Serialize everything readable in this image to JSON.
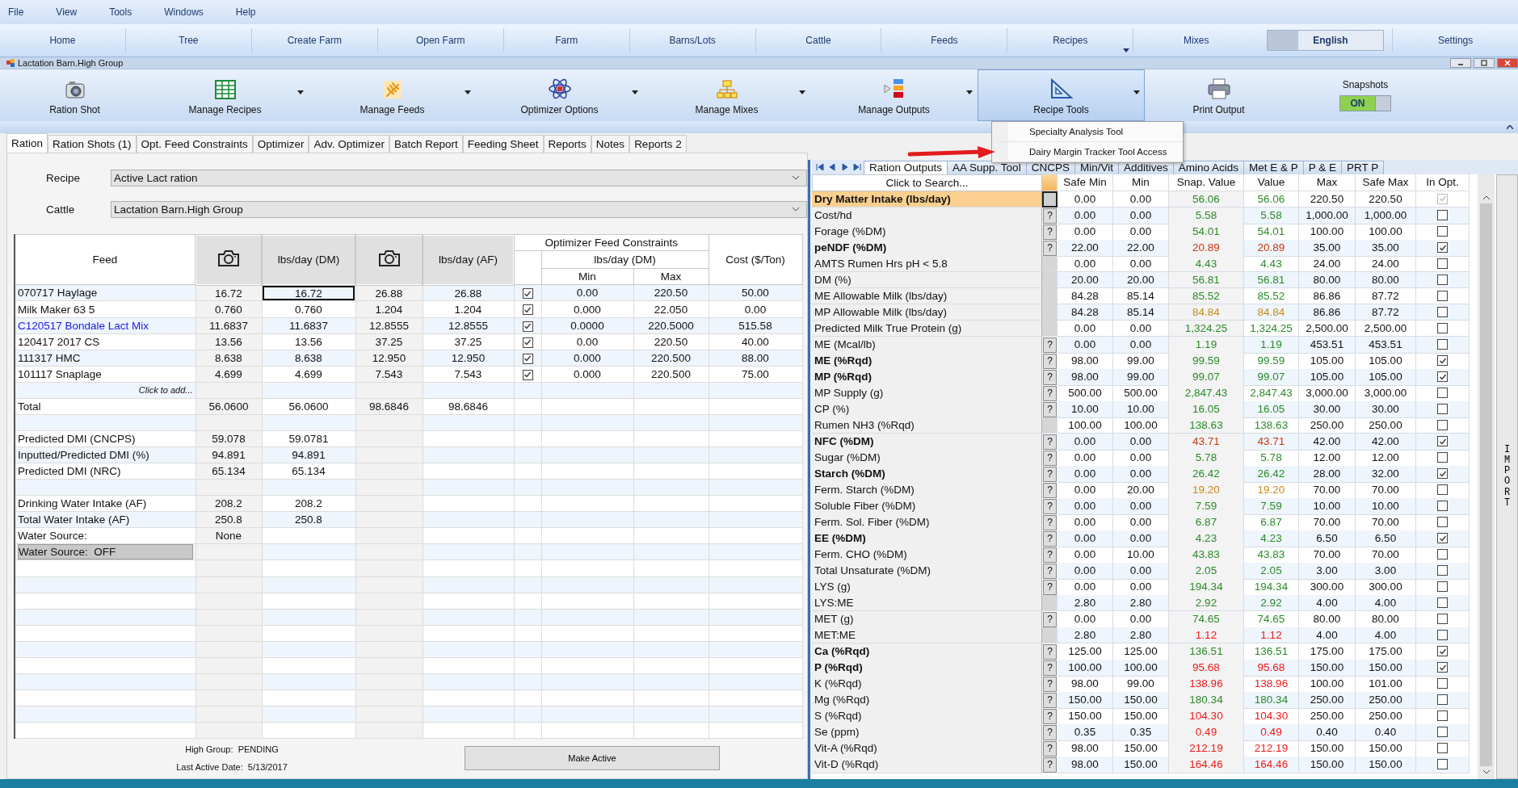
{
  "menu_bar": [
    "File",
    "View",
    "Tools",
    "Windows",
    "Help"
  ],
  "nav": [
    {
      "label": "Home",
      "kind": "link"
    },
    {
      "label": "Tree",
      "kind": "link"
    },
    {
      "label": "Create Farm",
      "kind": "link"
    },
    {
      "label": "Open Farm",
      "kind": "link"
    },
    {
      "label": "Farm",
      "kind": "link"
    },
    {
      "label": "Barns/Lots",
      "kind": "link"
    },
    {
      "label": "Cattle",
      "kind": "link"
    },
    {
      "label": "Feeds",
      "kind": "link"
    },
    {
      "label": "Recipes",
      "kind": "dropdown"
    },
    {
      "label": "Mixes",
      "kind": "link"
    },
    {
      "label": "English",
      "kind": "language"
    },
    {
      "label": "Settings",
      "kind": "link"
    }
  ],
  "window": {
    "title": "Lactation Barn.High Group"
  },
  "toolbar": [
    {
      "label": "Ration Shot",
      "kind": "camera",
      "dropdown": false,
      "selected": false
    },
    {
      "label": "Manage Recipes",
      "kind": "grid",
      "dropdown": true,
      "selected": false
    },
    {
      "label": "Manage Feeds",
      "kind": "wheat",
      "dropdown": true,
      "selected": false
    },
    {
      "label": "Optimizer Options",
      "kind": "atom",
      "dropdown": true,
      "selected": false
    },
    {
      "label": "Manage Mixes",
      "kind": "hierarchy",
      "dropdown": true,
      "selected": false
    },
    {
      "label": "Manage Outputs",
      "kind": "outputs",
      "dropdown": true,
      "selected": false
    },
    {
      "label": "Recipe Tools",
      "kind": "setsquare",
      "dropdown": true,
      "selected": true,
      "menu": [
        "Specialty Analysis Tool",
        "Dairy Margin Tracker Tool Access"
      ]
    },
    {
      "label": "Print Output",
      "kind": "printer",
      "dropdown": false,
      "selected": false
    }
  ],
  "snapshots": {
    "label": "Snapshots",
    "state": "ON",
    "on": true
  },
  "tabs": [
    {
      "label": "Ration",
      "selected": true
    },
    {
      "label": "Ration Shots (1)",
      "selected": false
    },
    {
      "label": "Opt. Feed Constraints",
      "selected": false
    },
    {
      "label": "Optimizer",
      "selected": false
    },
    {
      "label": "Adv. Optimizer",
      "selected": false
    },
    {
      "label": "Batch Report",
      "selected": false
    },
    {
      "label": "Feeding Sheet",
      "selected": false
    },
    {
      "label": "Reports",
      "selected": false
    },
    {
      "label": "Notes",
      "selected": false
    },
    {
      "label": "Reports 2",
      "selected": false
    }
  ],
  "fields": [
    {
      "label": "Recipe",
      "value": "Active Lact ration"
    },
    {
      "label": "Cattle",
      "value": "Lactation Barn.High Group"
    }
  ],
  "feed_table": {
    "columns": {
      "feed": "Feed",
      "dm": "lbs/day (DM)",
      "af": "lbs/day (AF)",
      "group": "Optimizer Feed Constraints",
      "subgroup": "lbs/day (DM)",
      "min": "Min",
      "max": "Max",
      "cost": "Cost ($/Ton)"
    },
    "rows": [
      {
        "kind": "feed",
        "name": "070717 Haylage",
        "link": false,
        "focused": true,
        "snap_dm": "16.72",
        "dm": "16.72",
        "snap_af": "26.88",
        "af": "26.88",
        "optimize": true,
        "min": "0.00",
        "max": "220.50",
        "cost": "50.00"
      },
      {
        "kind": "feed",
        "name": "Milk Maker 63 5",
        "link": false,
        "focused": false,
        "snap_dm": "0.760",
        "dm": "0.760",
        "snap_af": "1.204",
        "af": "1.204",
        "optimize": true,
        "min": "0.000",
        "max": "22.050",
        "cost": "0.00"
      },
      {
        "kind": "feed",
        "name": "C120517 Bondale Lact Mix",
        "link": true,
        "focused": false,
        "snap_dm": "11.6837",
        "dm": "11.6837",
        "snap_af": "12.8555",
        "af": "12.8555",
        "optimize": true,
        "min": "0.0000",
        "max": "220.5000",
        "cost": "515.58"
      },
      {
        "kind": "feed",
        "name": "120417 2017 CS",
        "link": false,
        "focused": false,
        "snap_dm": "13.56",
        "dm": "13.56",
        "snap_af": "37.25",
        "af": "37.25",
        "optimize": true,
        "min": "0.00",
        "max": "220.50",
        "cost": "40.00"
      },
      {
        "kind": "feed",
        "name": "111317 HMC",
        "link": false,
        "focused": false,
        "snap_dm": "8.638",
        "dm": "8.638",
        "snap_af": "12.950",
        "af": "12.950",
        "optimize": true,
        "min": "0.000",
        "max": "220.500",
        "cost": "88.00"
      },
      {
        "kind": "feed",
        "name": "101117 Snaplage",
        "link": false,
        "focused": false,
        "snap_dm": "4.699",
        "dm": "4.699",
        "snap_af": "7.543",
        "af": "7.543",
        "optimize": true,
        "min": "0.000",
        "max": "220.500",
        "cost": "75.00"
      },
      {
        "kind": "add",
        "label": "Click to add..."
      },
      {
        "kind": "total",
        "label": "Total",
        "values": [
          "56.0600",
          "56.0600",
          "98.6846",
          "98.6846"
        ]
      },
      {
        "kind": "blank"
      },
      {
        "kind": "stat",
        "label": "Predicted DMI (CNCPS)",
        "values": [
          "59.078",
          "59.0781"
        ]
      },
      {
        "kind": "stat",
        "label": "Inputted/Predicted DMI (%)",
        "values": [
          "94.891",
          "94.891"
        ]
      },
      {
        "kind": "stat",
        "label": "Predicted DMI (NRC)",
        "values": [
          "65.134",
          "65.134"
        ]
      },
      {
        "kind": "blank"
      },
      {
        "kind": "stat",
        "label": "Drinking Water Intake (AF)",
        "values": [
          "208.2",
          "208.2"
        ]
      },
      {
        "kind": "stat",
        "label": "Total Water Intake (AF)",
        "values": [
          "250.8",
          "250.8"
        ]
      },
      {
        "kind": "stat",
        "label": "Water Source:",
        "values": [
          "None"
        ]
      },
      {
        "kind": "toggle",
        "label": "Water Source:  OFF"
      }
    ]
  },
  "status": {
    "group": "High Group:  PENDING",
    "date": "Last Active Date:  5/13/2017",
    "button": "Make Active"
  },
  "outputs": {
    "tabs": [
      {
        "label": "Ration Outputs",
        "selected": true
      },
      {
        "label": "AA Supp. Tool",
        "selected": false
      },
      {
        "label": "CNCPS",
        "selected": false
      },
      {
        "label": "Min/Vit",
        "selected": false
      },
      {
        "label": "Additives",
        "selected": false
      },
      {
        "label": "Amino Acids",
        "selected": false
      },
      {
        "label": "Met E & P",
        "selected": false
      },
      {
        "label": "P & E",
        "selected": false
      },
      {
        "label": "PRT P",
        "selected": false
      }
    ],
    "search": {
      "placeholder": "Click to Search..."
    },
    "columns": [
      "Safe Min",
      "Min",
      "Snap. Value",
      "Value",
      "Max",
      "Safe Max",
      "In Opt."
    ],
    "rows": [
      {
        "label": "Dry Matter Intake (lbs/day)",
        "bold": true,
        "help": false,
        "selected": true,
        "values": [
          "0.00",
          "0.00",
          "56.06",
          "56.06",
          "220.50",
          "220.50"
        ],
        "color": "#2a8a2a",
        "in_opt": true,
        "disabled": true
      },
      {
        "label": "Cost/hd",
        "bold": false,
        "help": true,
        "selected": false,
        "values": [
          "0.00",
          "0.00",
          "5.58",
          "5.58",
          "1,000.00",
          "1,000.00"
        ],
        "color": "#2a8a2a",
        "in_opt": false,
        "disabled": false
      },
      {
        "label": "Forage (%DM)",
        "bold": false,
        "help": true,
        "selected": false,
        "values": [
          "0.00",
          "0.00",
          "54.01",
          "54.01",
          "100.00",
          "100.00"
        ],
        "color": "#2a8a2a",
        "in_opt": false,
        "disabled": false
      },
      {
        "label": "peNDF (%DM)",
        "bold": true,
        "help": true,
        "selected": false,
        "values": [
          "22.00",
          "22.00",
          "20.89",
          "20.89",
          "35.00",
          "35.00"
        ],
        "color": "#c8370f",
        "in_opt": true,
        "disabled": false
      },
      {
        "label": "AMTS Rumen Hrs pH < 5.8",
        "bold": false,
        "help": false,
        "selected": false,
        "values": [
          "0.00",
          "0.00",
          "4.43",
          "4.43",
          "24.00",
          "24.00"
        ],
        "color": "#2a8a2a",
        "in_opt": false,
        "disabled": false
      },
      {
        "label": "DM (%)",
        "bold": false,
        "help": false,
        "selected": false,
        "values": [
          "20.00",
          "20.00",
          "56.81",
          "56.81",
          "80.00",
          "80.00"
        ],
        "color": "#2a8a2a",
        "in_opt": false,
        "disabled": false
      },
      {
        "label": "ME Allowable Milk (lbs/day)",
        "bold": false,
        "help": false,
        "selected": false,
        "values": [
          "84.28",
          "85.14",
          "85.52",
          "85.52",
          "86.86",
          "87.72"
        ],
        "color": "#2a8a2a",
        "in_opt": false,
        "disabled": false
      },
      {
        "label": "MP Allowable Milk (lbs/day)",
        "bold": false,
        "help": false,
        "selected": false,
        "values": [
          "84.28",
          "85.14",
          "84.84",
          "84.84",
          "86.86",
          "87.72"
        ],
        "color": "#c98a1a",
        "in_opt": false,
        "disabled": false
      },
      {
        "label": "Predicted Milk True Protein (g)",
        "bold": false,
        "help": false,
        "selected": false,
        "values": [
          "0.00",
          "0.00",
          "1,324.25",
          "1,324.25",
          "2,500.00",
          "2,500.00"
        ],
        "color": "#2a8a2a",
        "in_opt": false,
        "disabled": false
      },
      {
        "label": "ME (Mcal/lb)",
        "bold": false,
        "help": true,
        "selected": false,
        "values": [
          "0.00",
          "0.00",
          "1.19",
          "1.19",
          "453.51",
          "453.51"
        ],
        "color": "#2a8a2a",
        "in_opt": false,
        "disabled": false
      },
      {
        "label": "ME (%Rqd)",
        "bold": true,
        "help": true,
        "selected": false,
        "values": [
          "98.00",
          "99.00",
          "99.59",
          "99.59",
          "105.00",
          "105.00"
        ],
        "color": "#2a8a2a",
        "in_opt": true,
        "disabled": false
      },
      {
        "label": "MP (%Rqd)",
        "bold": true,
        "help": true,
        "selected": false,
        "values": [
          "98.00",
          "99.00",
          "99.07",
          "99.07",
          "105.00",
          "105.00"
        ],
        "color": "#2a8a2a",
        "in_opt": true,
        "disabled": false
      },
      {
        "label": "MP Supply (g)",
        "bold": false,
        "help": true,
        "selected": false,
        "values": [
          "500.00",
          "500.00",
          "2,847.43",
          "2,847.43",
          "3,000.00",
          "3,000.00"
        ],
        "color": "#2a8a2a",
        "in_opt": false,
        "disabled": false
      },
      {
        "label": "CP (%)",
        "bold": false,
        "help": true,
        "selected": false,
        "values": [
          "10.00",
          "10.00",
          "16.05",
          "16.05",
          "30.00",
          "30.00"
        ],
        "color": "#2a8a2a",
        "in_opt": false,
        "disabled": false
      },
      {
        "label": "Rumen NH3 (%Rqd)",
        "bold": false,
        "help": false,
        "selected": false,
        "values": [
          "100.00",
          "100.00",
          "138.63",
          "138.63",
          "250.00",
          "250.00"
        ],
        "color": "#2a8a2a",
        "in_opt": false,
        "disabled": false
      },
      {
        "label": "NFC (%DM)",
        "bold": true,
        "help": true,
        "selected": false,
        "values": [
          "0.00",
          "0.00",
          "43.71",
          "43.71",
          "42.00",
          "42.00"
        ],
        "color": "#c8370f",
        "in_opt": true,
        "disabled": false
      },
      {
        "label": "Sugar (%DM)",
        "bold": false,
        "help": true,
        "selected": false,
        "values": [
          "0.00",
          "0.00",
          "5.78",
          "5.78",
          "12.00",
          "12.00"
        ],
        "color": "#2a8a2a",
        "in_opt": false,
        "disabled": false
      },
      {
        "label": "Starch (%DM)",
        "bold": true,
        "help": true,
        "selected": false,
        "values": [
          "0.00",
          "0.00",
          "26.42",
          "26.42",
          "28.00",
          "32.00"
        ],
        "color": "#2a8a2a",
        "in_opt": true,
        "disabled": false
      },
      {
        "label": "Ferm. Starch (%DM)",
        "bold": false,
        "help": true,
        "selected": false,
        "values": [
          "0.00",
          "20.00",
          "19.20",
          "19.20",
          "70.00",
          "70.00"
        ],
        "color": "#c98a1a",
        "in_opt": false,
        "disabled": false
      },
      {
        "label": "Soluble Fiber (%DM)",
        "bold": false,
        "help": true,
        "selected": false,
        "values": [
          "0.00",
          "0.00",
          "7.59",
          "7.59",
          "10.00",
          "10.00"
        ],
        "color": "#2a8a2a",
        "in_opt": false,
        "disabled": false
      },
      {
        "label": "Ferm. Sol. Fiber (%DM)",
        "bold": false,
        "help": true,
        "selected": false,
        "values": [
          "0.00",
          "0.00",
          "6.87",
          "6.87",
          "70.00",
          "70.00"
        ],
        "color": "#2a8a2a",
        "in_opt": false,
        "disabled": false
      },
      {
        "label": "EE (%DM)",
        "bold": true,
        "help": true,
        "selected": false,
        "values": [
          "0.00",
          "0.00",
          "4.23",
          "4.23",
          "6.50",
          "6.50"
        ],
        "color": "#2a8a2a",
        "in_opt": true,
        "disabled": false
      },
      {
        "label": "Ferm. CHO (%DM)",
        "bold": false,
        "help": true,
        "selected": false,
        "values": [
          "0.00",
          "10.00",
          "43.83",
          "43.83",
          "70.00",
          "70.00"
        ],
        "color": "#2a8a2a",
        "in_opt": false,
        "disabled": false
      },
      {
        "label": "Total Unsaturate (%DM)",
        "bold": false,
        "help": true,
        "selected": false,
        "values": [
          "0.00",
          "0.00",
          "2.05",
          "2.05",
          "3.00",
          "3.00"
        ],
        "color": "#2a8a2a",
        "in_opt": false,
        "disabled": false
      },
      {
        "label": "LYS (g)",
        "bold": false,
        "help": true,
        "selected": false,
        "values": [
          "0.00",
          "0.00",
          "194.34",
          "194.34",
          "300.00",
          "300.00"
        ],
        "color": "#2a8a2a",
        "in_opt": false,
        "disabled": false
      },
      {
        "label": "LYS:ME",
        "bold": false,
        "help": false,
        "selected": false,
        "values": [
          "2.80",
          "2.80",
          "2.92",
          "2.92",
          "4.00",
          "4.00"
        ],
        "color": "#2a8a2a",
        "in_opt": false,
        "disabled": false
      },
      {
        "label": "MET (g)",
        "bold": false,
        "help": true,
        "selected": false,
        "values": [
          "0.00",
          "0.00",
          "74.65",
          "74.65",
          "80.00",
          "80.00"
        ],
        "color": "#2a8a2a",
        "in_opt": false,
        "disabled": false
      },
      {
        "label": "MET:ME",
        "bold": false,
        "help": false,
        "selected": false,
        "values": [
          "2.80",
          "2.80",
          "1.12",
          "1.12",
          "4.00",
          "4.00"
        ],
        "color": "#f01818",
        "in_opt": false,
        "disabled": false
      },
      {
        "label": "Ca (%Rqd)",
        "bold": true,
        "help": true,
        "selected": false,
        "values": [
          "125.00",
          "125.00",
          "136.51",
          "136.51",
          "175.00",
          "175.00"
        ],
        "color": "#2a8a2a",
        "in_opt": true,
        "disabled": false
      },
      {
        "label": "P (%Rqd)",
        "bold": true,
        "help": true,
        "selected": false,
        "values": [
          "100.00",
          "100.00",
          "95.68",
          "95.68",
          "150.00",
          "150.00"
        ],
        "color": "#f01818",
        "in_opt": true,
        "disabled": false
      },
      {
        "label": "K (%Rqd)",
        "bold": false,
        "help": true,
        "selected": false,
        "values": [
          "98.00",
          "99.00",
          "138.96",
          "138.96",
          "100.00",
          "101.00"
        ],
        "color": "#f01818",
        "in_opt": false,
        "disabled": false
      },
      {
        "label": "Mg (%Rqd)",
        "bold": false,
        "help": true,
        "selected": false,
        "values": [
          "150.00",
          "150.00",
          "180.34",
          "180.34",
          "250.00",
          "250.00"
        ],
        "color": "#2a8a2a",
        "in_opt": false,
        "disabled": false
      },
      {
        "label": "S (%Rqd)",
        "bold": false,
        "help": true,
        "selected": false,
        "values": [
          "150.00",
          "150.00",
          "104.30",
          "104.30",
          "250.00",
          "250.00"
        ],
        "color": "#f01818",
        "in_opt": false,
        "disabled": false
      },
      {
        "label": "Se (ppm)",
        "bold": false,
        "help": true,
        "selected": false,
        "values": [
          "0.35",
          "0.35",
          "0.49",
          "0.49",
          "0.40",
          "0.40"
        ],
        "color": "#f01818",
        "in_opt": false,
        "disabled": false
      },
      {
        "label": "Vit-A (%Rqd)",
        "bold": false,
        "help": true,
        "selected": false,
        "values": [
          "98.00",
          "150.00",
          "212.19",
          "212.19",
          "150.00",
          "150.00"
        ],
        "color": "#f01818",
        "in_opt": false,
        "disabled": false
      },
      {
        "label": "Vit-D (%Rqd)",
        "bold": false,
        "help": true,
        "selected": false,
        "values": [
          "98.00",
          "150.00",
          "164.46",
          "164.46",
          "150.00",
          "150.00"
        ],
        "color": "#f01818",
        "in_opt": false,
        "disabled": false
      }
    ],
    "help_mark": "?",
    "side_button": "IMPORT"
  }
}
